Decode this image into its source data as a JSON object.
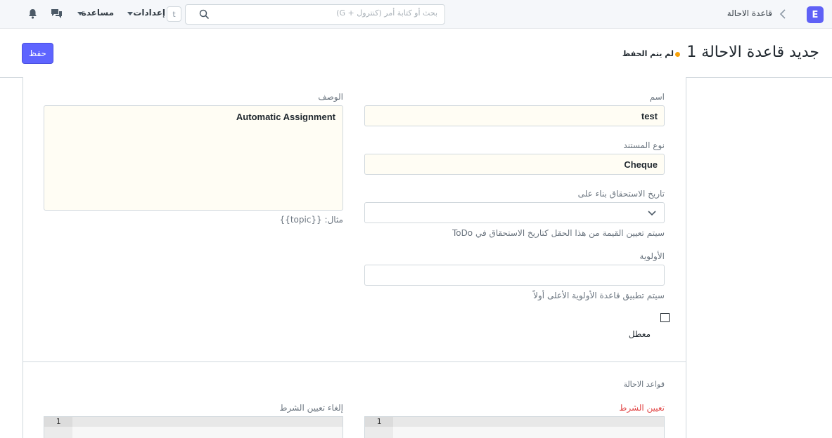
{
  "navbar": {
    "logo_letter": "E",
    "breadcrumb": "قاعدة الاحالة",
    "search_placeholder": "بحث أو كتابة أمر (كنترول + G)",
    "shortcut_key": "t",
    "settings_label": "إعدادات",
    "help_label": "مساعدة"
  },
  "page": {
    "title": "جديد قاعدة الاحالة 1",
    "status": "لم يتم الحفظ",
    "save_label": "حفظ"
  },
  "form": {
    "name_label": "اسم",
    "name_value": "test",
    "doctype_label": "نوع المستند",
    "doctype_value": "Cheque",
    "due_date_label": "تاريخ الاستحقاق بناء على",
    "due_date_value": "",
    "due_date_help": "سيتم تعيين القيمة من هذا الحقل كتاريخ الاستحقاق في ToDo",
    "priority_label": "الأولوية",
    "priority_value": "",
    "priority_help": "سيتم تطبيق قاعدة الأولوية الأعلى أولاً",
    "disabled_label": "معطل",
    "description_label": "الوصف",
    "description_value": "Automatic Assignment",
    "description_help": "مثال: {{topic}}"
  },
  "rules_section": {
    "title": "قواعد الاحالة",
    "assign_condition_label": "تعيين الشرط",
    "unassign_condition_label": "إلغاء تعيين الشرط",
    "line_number": "1"
  },
  "colors": {
    "primary": "#5e64ff",
    "unsaved": "#f8a20a",
    "required": "#e24c4c"
  }
}
